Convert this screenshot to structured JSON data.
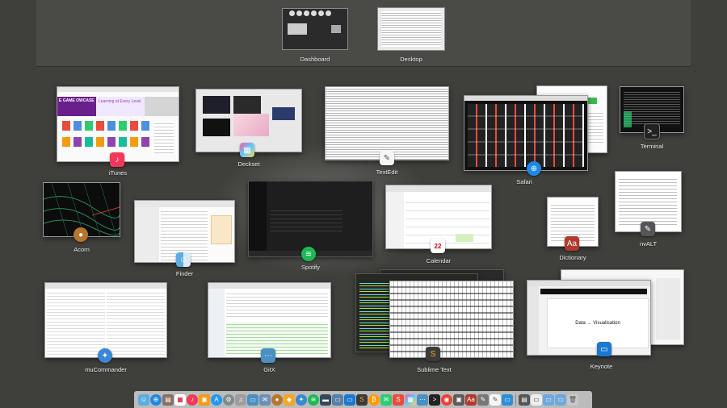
{
  "spaces": [
    {
      "label": "Dashboard"
    },
    {
      "label": "Desktop"
    }
  ],
  "windows": [
    {
      "id": "itunes",
      "label": "iTunes",
      "header_text": "E GAME OWCASE",
      "promo_text": "Learning at Every Level"
    },
    {
      "id": "deckset",
      "label": "Deckset"
    },
    {
      "id": "textedit",
      "label": "TextEdit"
    },
    {
      "id": "safari",
      "label": "Safari"
    },
    {
      "id": "terminal",
      "label": "Terminal"
    },
    {
      "id": "acorn",
      "label": "Acorn"
    },
    {
      "id": "finder",
      "label": "Finder"
    },
    {
      "id": "spotify",
      "label": "Spotify"
    },
    {
      "id": "calendar",
      "label": "Calendar",
      "icon_text": "22"
    },
    {
      "id": "dictionary",
      "label": "Dictionary"
    },
    {
      "id": "nvalt",
      "label": "nvALT"
    },
    {
      "id": "mucommander",
      "label": "muCommander"
    },
    {
      "id": "gitx",
      "label": "GitX"
    },
    {
      "id": "sublime",
      "label": "Sublime Text"
    },
    {
      "id": "keynote",
      "label": "Keynote",
      "slide_title": "Data → Visualisation"
    }
  ],
  "colors": {
    "background": "#3f3f3c",
    "spaces_bar": "#4a4a47",
    "dock": "#d2d2d2"
  }
}
